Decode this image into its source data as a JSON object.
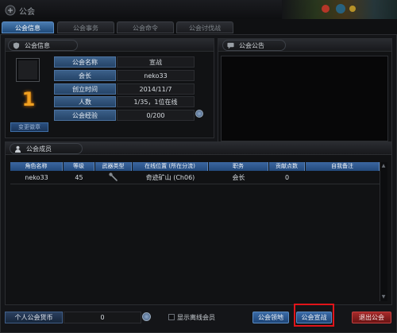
{
  "window": {
    "title": "公会"
  },
  "tabs": [
    {
      "label": "公会信息",
      "active": true
    },
    {
      "label": "公会事务",
      "active": false
    },
    {
      "label": "公会命令",
      "active": false
    },
    {
      "label": "公会讨伐战",
      "active": false
    }
  ],
  "guild_info": {
    "header": "公会信息",
    "rank_number": "1",
    "change_emblem_label": "变更徽章",
    "rows": [
      {
        "label": "公会名称",
        "value": "宣战"
      },
      {
        "label": "会长",
        "value": "neko33"
      },
      {
        "label": "创立时间",
        "value": "2014/11/7"
      },
      {
        "label": "人数",
        "value": "1/35，1位在线"
      },
      {
        "label": "公会经验",
        "value": "0/200"
      }
    ]
  },
  "notice": {
    "header": "公会公告"
  },
  "members": {
    "header": "公会成员",
    "columns": [
      "角色名称",
      "等级",
      "武器类型",
      "在线位置 (所在分流)",
      "职务",
      "贡献点数",
      "自我备注"
    ],
    "rows": [
      {
        "name": "neko33",
        "level": "45",
        "weapon_icon": "wrench-icon",
        "location": "奇迹矿山 (Ch06)",
        "position": "会长",
        "points": "0",
        "note": ""
      }
    ]
  },
  "footer": {
    "fund_label": "个人公会货币",
    "fund_value": "0",
    "offline_label": "显示离线会员",
    "territory_button": "公会领地",
    "war_button": "公会宣战",
    "leave_button": "退出公会"
  },
  "colors": {
    "accent": "#3a6aa6",
    "danger": "#a52a2a",
    "highlight": "#e0141a",
    "rank": "#f0a020"
  }
}
